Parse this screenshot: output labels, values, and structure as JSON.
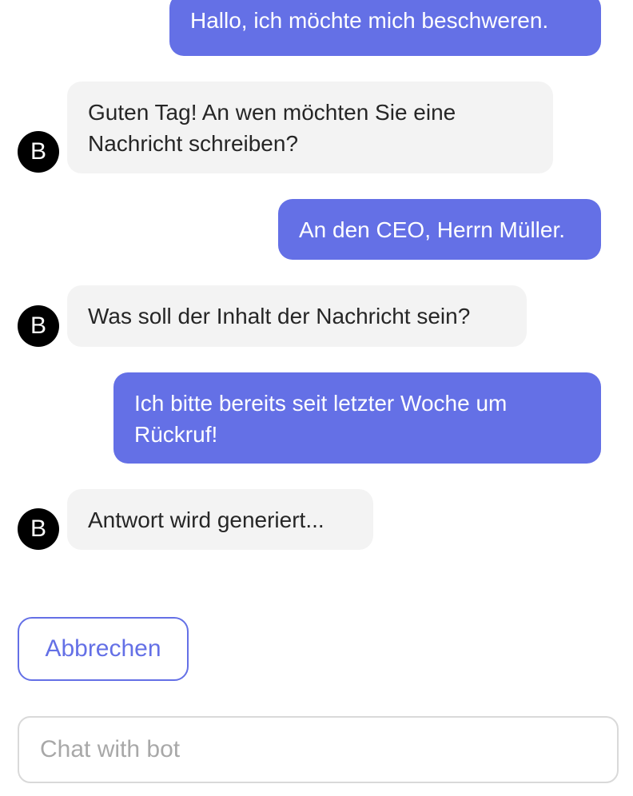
{
  "messages": [
    {
      "role": "user",
      "text": "Hallo, ich möchte mich beschweren."
    },
    {
      "role": "bot",
      "avatar": "B",
      "text": "Guten Tag! An wen möchten Sie eine Nachricht schreiben?"
    },
    {
      "role": "user",
      "text": "An den CEO, Herrn Müller."
    },
    {
      "role": "bot",
      "avatar": "B",
      "text": "Was soll der Inhalt der Nachricht sein?"
    },
    {
      "role": "user",
      "text": "Ich bitte bereits seit letzter Woche um Rückruf!"
    },
    {
      "role": "bot",
      "avatar": "B",
      "text": "Antwort wird generiert..."
    }
  ],
  "actions": {
    "cancel_label": "Abbrechen"
  },
  "input": {
    "placeholder": "Chat with bot",
    "value": ""
  },
  "colors": {
    "user_bubble": "#6470e6",
    "bot_bubble": "#f3f3f3",
    "avatar": "#000000",
    "accent": "#6470e6"
  }
}
